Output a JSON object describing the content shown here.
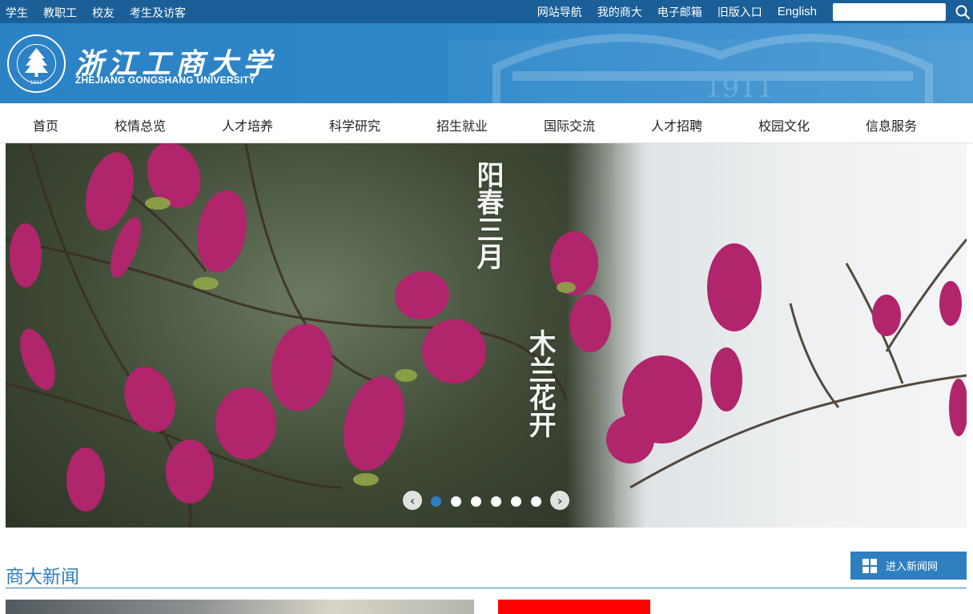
{
  "topbar": {
    "left_links": [
      "学生",
      "教职工",
      "校友",
      "考生及访客"
    ],
    "right_links": [
      "网站导航",
      "我的商大",
      "电子邮箱",
      "旧版入口"
    ],
    "english_link": "English",
    "search_value": ""
  },
  "header": {
    "logo_cn": "浙江工商大学",
    "logo_en": "ZHEJIANG GONGSHANG UNIVERSITY",
    "gate_year": "1911",
    "seal_year": "1911"
  },
  "nav": {
    "items": [
      "首页",
      "校情总览",
      "人才培养",
      "科学研究",
      "招生就业",
      "国际交流",
      "人才招聘",
      "校园文化",
      "信息服务"
    ]
  },
  "banner": {
    "poem_col1": "阳春三月",
    "poem_col2": "木兰花开",
    "slide_count": 6,
    "active_slide": 1
  },
  "news": {
    "section_title": "商大新闻",
    "enter_label": "进入新闻网"
  },
  "colors": {
    "topbar": "#1a5f97",
    "header": "#2b82c5",
    "accent": "#2e7fc0"
  }
}
